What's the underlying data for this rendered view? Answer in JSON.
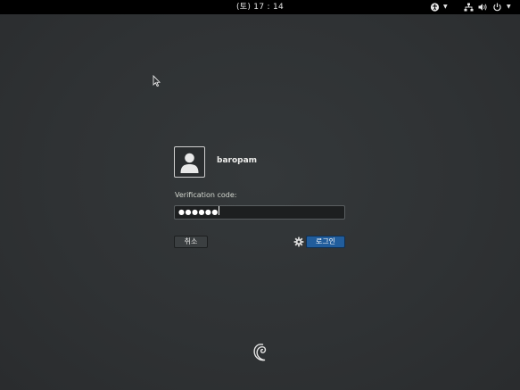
{
  "topbar": {
    "clock": "(토) 17 : 14",
    "icons": {
      "accessibility": "accessibility-icon",
      "network": "network-icon",
      "volume": "volume-icon",
      "power": "power-icon"
    }
  },
  "login": {
    "username": "baropam",
    "prompt_label": "Verification code:",
    "password_mask": "●●●●●●",
    "cancel_label": "취소",
    "login_label": "로그인",
    "icons": {
      "avatar": "user-avatar-icon",
      "session": "gear-icon",
      "logo": "debian-swirl-logo"
    }
  },
  "colors": {
    "background": "#2e3133",
    "topbar": "#000000",
    "login_button": "#215d9c",
    "text": "#eeeeec"
  }
}
